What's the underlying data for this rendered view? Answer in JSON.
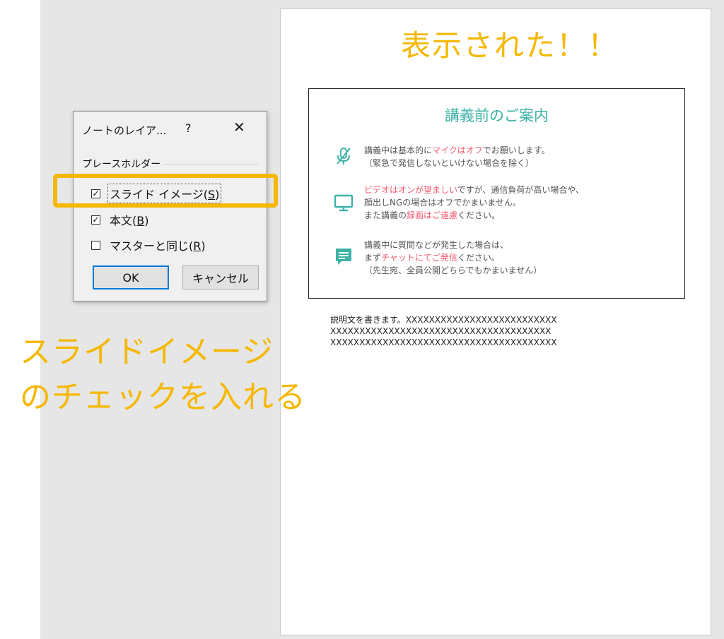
{
  "page_caption": "表示された！！",
  "slide": {
    "title": "講義前のご案内",
    "items": [
      {
        "icon": "mic-off-icon",
        "lines": [
          [
            {
              "t": "講義中は基本的に"
            },
            {
              "t": "マイクはオフ",
              "hl": true
            },
            {
              "t": "でお願いします。"
            }
          ],
          [
            {
              "t": "（緊急で発信しないといけない場合を除く）"
            }
          ]
        ]
      },
      {
        "icon": "monitor-icon",
        "lines": [
          [
            {
              "t": "ビデオはオンが望ましい",
              "hl": true
            },
            {
              "t": "ですが、通信負荷が高い場合や、"
            }
          ],
          [
            {
              "t": "顔出しNGの場合はオフでかまいません。"
            }
          ],
          [
            {
              "t": "また講義の"
            },
            {
              "t": "録画はご遠慮",
              "hl": true
            },
            {
              "t": "ください。"
            }
          ]
        ]
      },
      {
        "icon": "chat-icon",
        "lines": [
          [
            {
              "t": "講義中に質問などが発生した場合は、"
            }
          ],
          [
            {
              "t": "まず"
            },
            {
              "t": "チャットにてご発信",
              "hl": true
            },
            {
              "t": "ください。"
            }
          ],
          [
            {
              "t": "（先生宛、全員公開どちらでもかまいません）"
            }
          ]
        ]
      }
    ]
  },
  "notes": {
    "line1": "説明文を書きます。XXXXXXXXXXXXXXXXXXXXXXXXXX",
    "line2": "XXXXXXXXXXXXXXXXXXXXXXXXXXXXXXXXXXXXXX",
    "line3": "XXXXXXXXXXXXXXXXXXXXXXXXXXXXXXXXXXXXXXX"
  },
  "dialog": {
    "title": "ノートのレイア...",
    "help": "?",
    "close": "✕",
    "group_label": "プレースホルダー",
    "options": [
      {
        "label_pre": "スライド イメージ(",
        "key": "S",
        "label_post": ")",
        "checked": true
      },
      {
        "label_pre": "本文(",
        "key": "B",
        "label_post": ")",
        "checked": true
      },
      {
        "label_pre": "マスターと同じ(",
        "key": "R",
        "label_post": ")",
        "checked": false
      }
    ],
    "ok_label": "OK",
    "cancel_label": "キャンセル"
  },
  "annotation": {
    "line1": "スライドイメージ",
    "line2": "のチェックを入れる"
  },
  "colors": {
    "accent_orange": "#f5b800",
    "teal": "#3db2a6",
    "highlight_pink": "#f05a6e",
    "ok_border": "#0078d7"
  }
}
